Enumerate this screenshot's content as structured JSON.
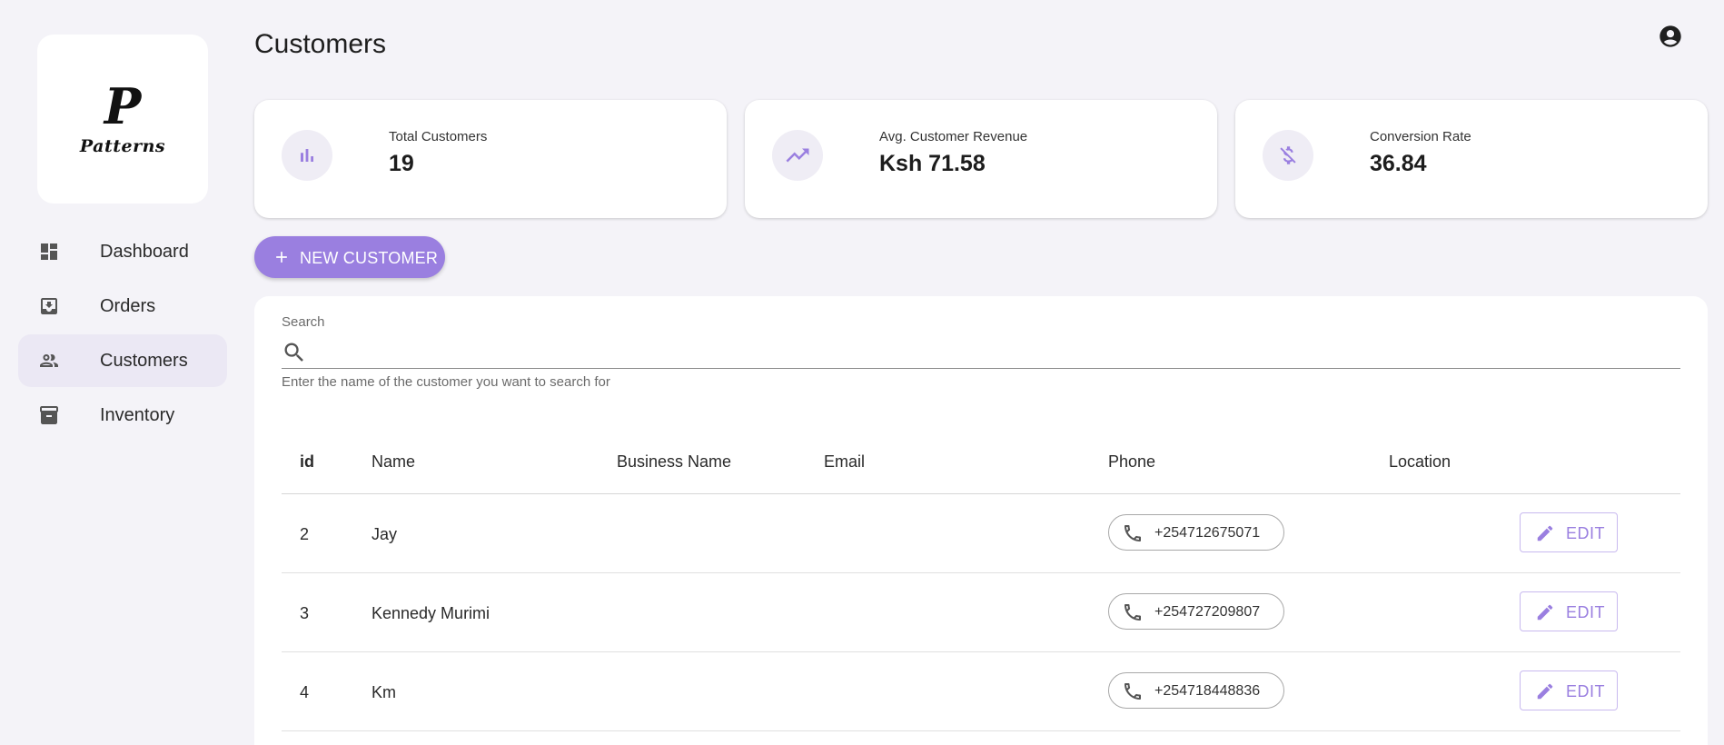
{
  "brand": {
    "mark": "P",
    "name": "Patterns"
  },
  "nav": {
    "items": [
      {
        "label": "Dashboard",
        "icon": "dashboard-icon"
      },
      {
        "label": "Orders",
        "icon": "inbox-arrow-icon"
      },
      {
        "label": "Customers",
        "icon": "people-icon",
        "active": true
      },
      {
        "label": "Inventory",
        "icon": "archive-box-icon"
      }
    ]
  },
  "header": {
    "title": "Customers",
    "account_icon": "account-circle-icon"
  },
  "stats": [
    {
      "label": "Total Customers",
      "value": "19",
      "icon": "bar-chart-icon"
    },
    {
      "label": "Avg. Customer Revenue",
      "value": "Ksh 71.58",
      "icon": "trending-up-icon"
    },
    {
      "label": "Conversion Rate",
      "value": "36.84",
      "icon": "money-off-icon"
    }
  ],
  "new_customer_button": {
    "label": "NEW CUSTOMER",
    "icon": "plus-icon"
  },
  "search": {
    "label": "Search",
    "value": "",
    "placeholder": "",
    "helper": "Enter the name of the customer you want to search for"
  },
  "table": {
    "columns": [
      "id",
      "Name",
      "Business Name",
      "Email",
      "Phone",
      "Location"
    ],
    "edit_label": "EDIT",
    "rows": [
      {
        "id": "2",
        "name": "Jay",
        "business": "",
        "email": "",
        "phone": "+254712675071",
        "location": ""
      },
      {
        "id": "3",
        "name": "Kennedy Murimi",
        "business": "",
        "email": "",
        "phone": "+254727209807",
        "location": ""
      },
      {
        "id": "4",
        "name": "Km",
        "business": "",
        "email": "",
        "phone": "+254718448836",
        "location": ""
      }
    ]
  },
  "colors": {
    "accent": "#9a7fe0",
    "background": "#f4f3f8",
    "active_nav": "#ebe8f4"
  }
}
